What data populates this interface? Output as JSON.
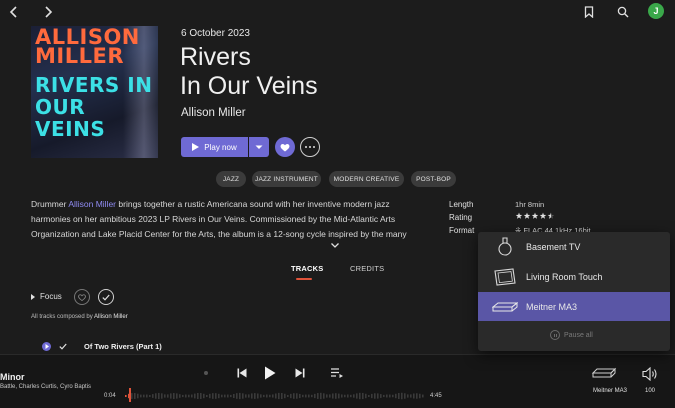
{
  "topbar": {
    "back_icon": "chevron-left-icon",
    "forward_icon": "chevron-right-icon",
    "bookmark_icon": "bookmark-icon",
    "search_icon": "search-icon",
    "avatar_initial": "J",
    "avatar_color": "#3aa84a"
  },
  "album": {
    "cover_line1": "ALLISON MILLER",
    "cover_line2": "RIVERS IN OUR VEINS",
    "release_date": "6 October 2023",
    "title_line1": "Rivers",
    "title_line2": "In Our Veins",
    "artist": "Allison Miller",
    "play_label": "Play now"
  },
  "tags": [
    "JAZZ",
    "JAZZ INSTRUMENT",
    "MODERN CREATIVE",
    "POST-BOP"
  ],
  "description": {
    "pre": "Drummer ",
    "link": "Allison Miller",
    "post": " brings together a rustic Americana sound with her inventive modern jazz harmonies on her ambitious 2023 LP Rivers in Our Veins. Commissioned by the Mid-Atlantic Arts Organization and Lake Placid Center for the Arts, the album is a 12-song cycle inspired by the many"
  },
  "meta": {
    "length_label": "Length",
    "length_value": "1hr 8min",
    "rating_label": "Rating",
    "rating_value": 4.5,
    "format_label": "Format",
    "format_value": "FLAC 44.1kHz 16bit"
  },
  "tabs": {
    "tracks": "TRACKS",
    "credits": "CREDITS"
  },
  "focus": {
    "label": "Focus"
  },
  "composed": {
    "prefix": "All tracks composed by ",
    "name": "Allison Miller"
  },
  "tracks": [
    {
      "title": "Of Two Rivers (Part 1)"
    }
  ],
  "player": {
    "now_playing_title": "Minor",
    "now_playing_artists": "Battle, Charles Curtis, Cyro Baptis",
    "elapsed": "0:04",
    "total": "4:45",
    "progress_fraction": 0.014,
    "device": "Meitner MA3",
    "volume": "100"
  },
  "devices": {
    "items": [
      {
        "name": "Basement TV",
        "icon": "speaker-icon",
        "selected": false
      },
      {
        "name": "Living Room Touch",
        "icon": "touch-display-icon",
        "selected": false
      },
      {
        "name": "Meitner MA3",
        "icon": "streamer-box-icon",
        "selected": true
      }
    ],
    "pause_all": "Pause all"
  },
  "colors": {
    "accent": "#6f6ad4",
    "selected_device": "#5a56a6",
    "progress": "#e0533a",
    "link": "#8f8bf2"
  }
}
